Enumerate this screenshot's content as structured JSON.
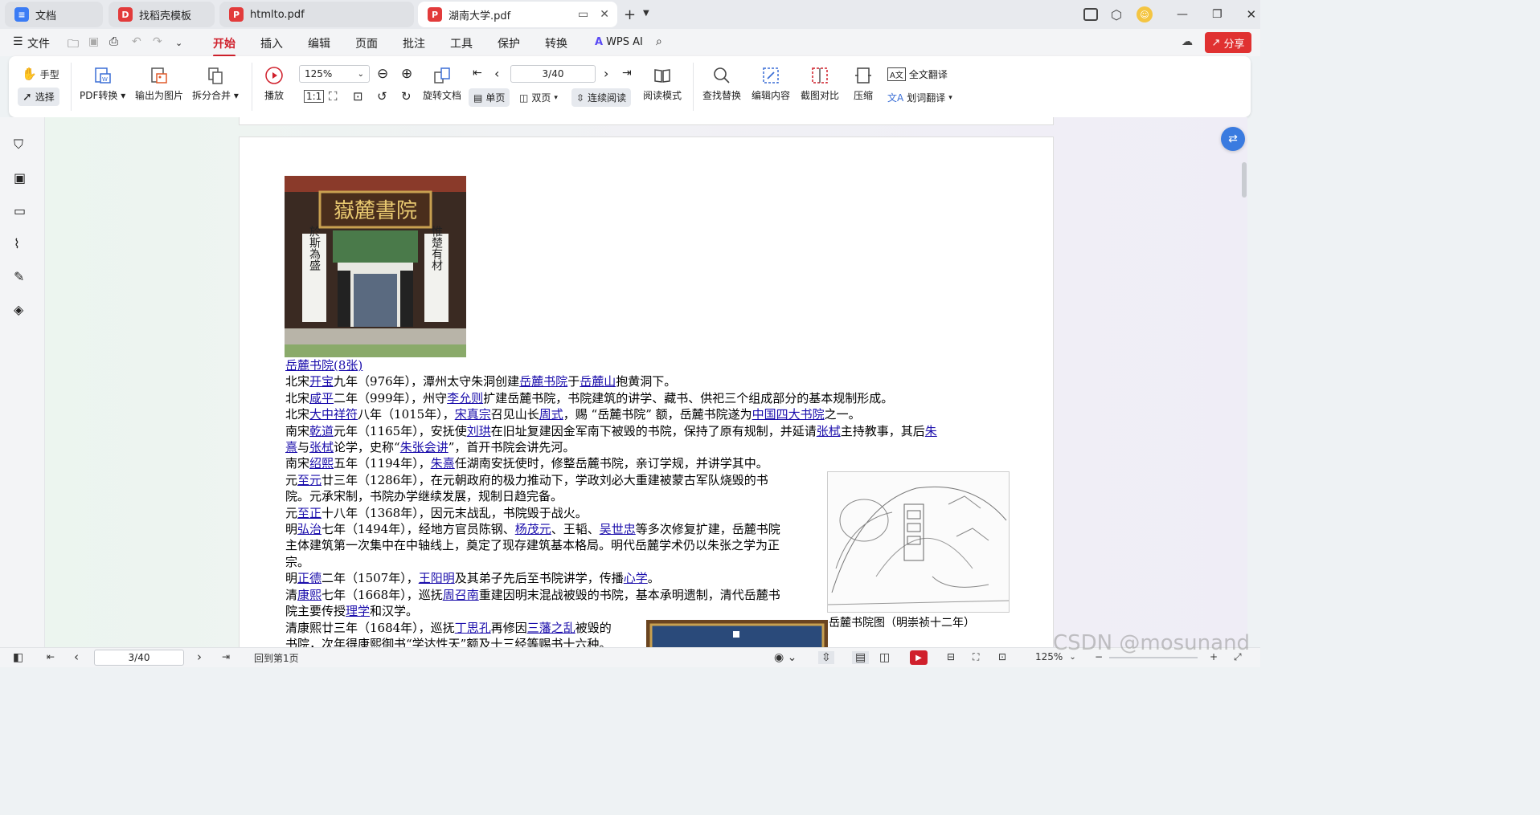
{
  "tabs": [
    {
      "label": "文档",
      "icon": "doc-icon",
      "color": "#3b7cf5"
    },
    {
      "label": "找稻壳模板",
      "icon": "docer-icon",
      "color": "#e23b3b"
    },
    {
      "label": "htmlto.pdf",
      "icon": "pdf-icon",
      "color": "#e23b3b"
    },
    {
      "label": "湖南大学.pdf",
      "icon": "pdf-icon",
      "color": "#e23b3b"
    }
  ],
  "menu": {
    "file": "文件",
    "items": [
      "开始",
      "插入",
      "编辑",
      "页面",
      "批注",
      "工具",
      "保护",
      "转换"
    ],
    "active": "开始",
    "wps_ai": "WPS AI",
    "share": "分享"
  },
  "ribbon": {
    "hand": "手型",
    "select": "选择",
    "pdf_convert": "PDF转换",
    "export_image": "输出为图片",
    "split_merge": "拆分合并",
    "play": "播放",
    "zoom": "125%",
    "page": "3/40",
    "rotate": "旋转文档",
    "single": "单页",
    "double": "双页",
    "continuous": "连续阅读",
    "read_mode": "阅读模式",
    "find_replace": "查找替换",
    "edit_content": "编辑内容",
    "screenshot_compare": "截图对比",
    "compress": "压缩",
    "full_translate": "全文翻译",
    "word_translate": "划词翻译"
  },
  "document": {
    "photo_link": "岳麓书院(8张)",
    "map_caption": "岳麓书院图（明崇祯十二年）",
    "lines": [
      [
        [
          "t",
          "北宋"
        ],
        [
          "a",
          "开宝"
        ],
        [
          "t",
          "九年（976年），潭州太守朱洞创建"
        ],
        [
          "a",
          "岳麓书院"
        ],
        [
          "t",
          "于"
        ],
        [
          "a",
          "岳麓山"
        ],
        [
          "t",
          "抱黄洞下。"
        ]
      ],
      [
        [
          "t",
          "北宋"
        ],
        [
          "a",
          "咸平"
        ],
        [
          "t",
          "二年（999年），州守"
        ],
        [
          "a",
          "李允则"
        ],
        [
          "t",
          "扩建岳麓书院，书院建筑的讲学、藏书、供祀三个组成部分的基本规制形成。"
        ]
      ],
      [
        [
          "t",
          "北宋"
        ],
        [
          "a",
          "大中祥符"
        ],
        [
          "t",
          "八年（1015年），"
        ],
        [
          "a",
          "宋真宗"
        ],
        [
          "t",
          "召见山长"
        ],
        [
          "a",
          "周式"
        ],
        [
          "t",
          "，赐 “岳麓书院” 额，岳麓书院遂为"
        ],
        [
          "a",
          "中国四大书院"
        ],
        [
          "t",
          "之一。"
        ]
      ],
      [
        [
          "t",
          "南宋"
        ],
        [
          "a",
          "乾道"
        ],
        [
          "t",
          "元年（1165年），安抚使"
        ],
        [
          "a",
          "刘珙"
        ],
        [
          "t",
          "在旧址复建因金军南下被毁的书院，保持了原有规制，并延请"
        ],
        [
          "a",
          "张栻"
        ],
        [
          "t",
          "主持教事，其后"
        ],
        [
          "a",
          "朱"
        ]
      ],
      [
        [
          "a",
          "熹"
        ],
        [
          "t",
          "与"
        ],
        [
          "a",
          "张栻"
        ],
        [
          "t",
          "论学，史称“"
        ],
        [
          "a",
          "朱张会讲"
        ],
        [
          "t",
          "”，首开书院会讲先河。"
        ]
      ],
      [
        [
          "t",
          "南宋"
        ],
        [
          "a",
          "绍熙"
        ],
        [
          "t",
          "五年（1194年），"
        ],
        [
          "a",
          "朱熹"
        ],
        [
          "t",
          "任湖南安抚使时，修整岳麓书院，亲订学规，并讲学其中。"
        ]
      ],
      [
        [
          "t",
          "元"
        ],
        [
          "a",
          "至元"
        ],
        [
          "t",
          "廿三年（1286年），在元朝政府的极力推动下，学政刘必大重建被蒙古军队烧毁的书"
        ]
      ],
      [
        [
          "t",
          "院。元承宋制，书院办学继续发展，规制日趋完备。"
        ]
      ],
      [
        [
          "t",
          "元"
        ],
        [
          "a",
          "至正"
        ],
        [
          "t",
          "十八年（1368年），因元末战乱，书院毁于战火。"
        ]
      ],
      [
        [
          "t",
          "明"
        ],
        [
          "a",
          "弘治"
        ],
        [
          "t",
          "七年（1494年），经地方官员陈钢、"
        ],
        [
          "a",
          "杨茂元"
        ],
        [
          "t",
          "、王韬、"
        ],
        [
          "a",
          "吴世忠"
        ],
        [
          "t",
          "等多次修复扩建，岳麓书院"
        ]
      ],
      [
        [
          "t",
          "主体建筑第一次集中在中轴线上，奠定了现存建筑基本格局。明代岳麓学术仍以朱张之学为正"
        ]
      ],
      [
        [
          "t",
          "宗。"
        ]
      ],
      [
        [
          "t",
          "明"
        ],
        [
          "a",
          "正德"
        ],
        [
          "t",
          "二年（1507年），"
        ],
        [
          "a",
          "王阳明"
        ],
        [
          "t",
          "及其弟子先后至书院讲学，传播"
        ],
        [
          "a",
          "心学"
        ],
        [
          "t",
          "。"
        ]
      ],
      [
        [
          "t",
          "清"
        ],
        [
          "a",
          "康熙"
        ],
        [
          "t",
          "七年（1668年），巡抚"
        ],
        [
          "a",
          "周召南"
        ],
        [
          "t",
          "重建因明末混战被毁的书院，基本承明遗制，清代岳麓书"
        ]
      ],
      [
        [
          "t",
          "院主要传授"
        ],
        [
          "a",
          "理学"
        ],
        [
          "t",
          "和汉学。"
        ]
      ],
      [
        [
          "t",
          "清康熙廿三年（1684年），巡抚"
        ],
        [
          "a",
          "丁思孔"
        ],
        [
          "t",
          "再修因"
        ],
        [
          "a",
          "三藩之乱"
        ],
        [
          "t",
          "被毁的"
        ]
      ],
      [
        [
          "t",
          "书院，次年得康熙御书“学达性天”额及十三经等赐书十六种。"
        ]
      ]
    ]
  },
  "photo_plaques": {
    "top": "嶽麓書院",
    "left": "於斯為盛",
    "right": "惟楚有材"
  },
  "status": {
    "page": "3/40",
    "back": "回到第1页",
    "zoom": "125%"
  },
  "watermark": "CSDN @mosunand",
  "colors": {
    "accent": "#d0202c",
    "link": "#1a0dab"
  }
}
